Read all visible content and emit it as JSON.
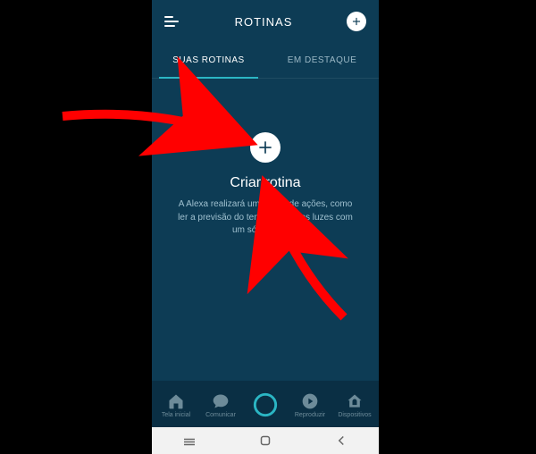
{
  "header": {
    "title": "ROTINAS"
  },
  "tabs": {
    "your": "SUAS ROTINAS",
    "featured": "EM DESTAQUE"
  },
  "content": {
    "create_title": "Criar rotina",
    "create_desc": "A Alexa realizará uma série de ações, como ler a previsão do tempo e ligar as luzes com um só comando."
  },
  "nav": {
    "home": "Tela inicial",
    "communicate": "Comunicar",
    "play": "Reproduzir",
    "devices": "Dispositivos"
  }
}
